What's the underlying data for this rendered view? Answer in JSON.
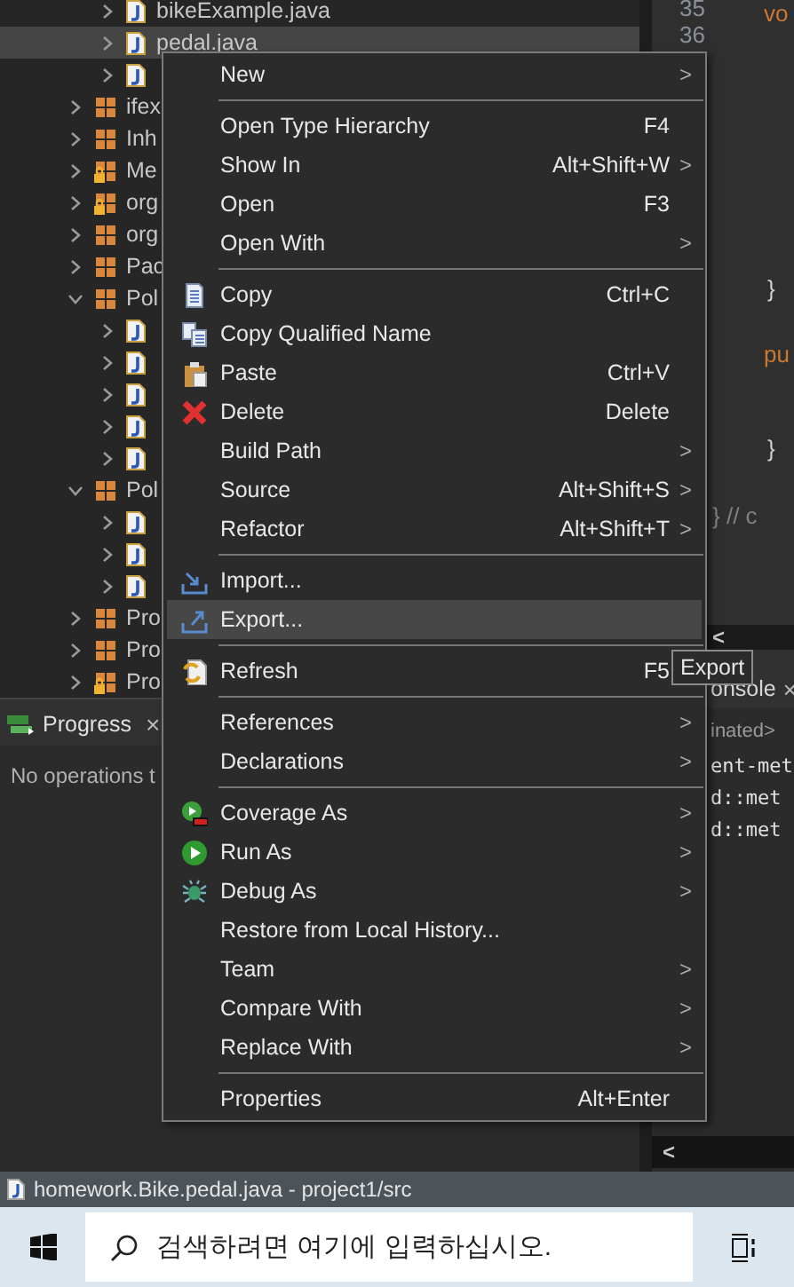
{
  "explorer": {
    "continued_files": [
      {
        "label": "bikeExample.java",
        "selected": false
      },
      {
        "label": "pedal.java",
        "selected": true
      },
      {
        "selected": false
      }
    ],
    "items": [
      {
        "label": "ifex",
        "locked": false,
        "expanded": false
      },
      {
        "label": "Inh",
        "locked": false,
        "expanded": false
      },
      {
        "label": "Me",
        "locked": true,
        "expanded": false
      },
      {
        "label": "org",
        "locked": true,
        "expanded": false
      },
      {
        "label": "org",
        "locked": false,
        "expanded": false
      },
      {
        "label": "Pac",
        "locked": false,
        "expanded": false
      },
      {
        "label": "Pol",
        "locked": false,
        "expanded": true,
        "children": [
          {
            "selected": false
          },
          {
            "selected": false
          },
          {
            "selected": false
          },
          {
            "selected": false
          },
          {
            "selected": false
          }
        ]
      },
      {
        "label": "Pol",
        "locked": false,
        "expanded": true,
        "children": [
          {
            "selected": false
          },
          {
            "selected": false
          },
          {
            "selected": false
          }
        ]
      },
      {
        "label": "Pro",
        "locked": false,
        "expanded": false
      },
      {
        "label": "Pro",
        "locked": false,
        "expanded": false
      },
      {
        "label": "Pro",
        "locked": true,
        "expanded": false
      }
    ]
  },
  "progress": {
    "tab": "Progress",
    "close": "×",
    "message": "No operations t"
  },
  "editor": {
    "line_numbers": [
      "35",
      "36"
    ],
    "code": [
      {
        "text": "vo",
        "kind": "keyword"
      },
      {
        "text": "}",
        "kind": "plain"
      },
      {
        "text": "pu",
        "kind": "keyword"
      },
      {
        "text": "}",
        "kind": "plain"
      },
      {
        "text": "} // c",
        "kind": "comment"
      }
    ],
    "scroll_arrow": "<"
  },
  "console": {
    "tab": "onsole",
    "close": "×",
    "status": "inated>",
    "lines": [
      "ent-met",
      "d::met",
      "d::met"
    ],
    "scroll_arrow": "<"
  },
  "context_menu": {
    "items": [
      {
        "kind": "item",
        "label": "New",
        "submenu": true,
        "selected": false
      },
      {
        "kind": "separator"
      },
      {
        "kind": "item",
        "label": "Open Type Hierarchy",
        "shortcut": "F4",
        "submenu": false,
        "selected": false
      },
      {
        "kind": "item",
        "label": "Show In",
        "shortcut": "Alt+Shift+W",
        "submenu": true,
        "selected": false
      },
      {
        "kind": "item",
        "label": "Open",
        "shortcut": "F3",
        "submenu": false,
        "selected": false
      },
      {
        "kind": "item",
        "label": "Open With",
        "submenu": true,
        "selected": false
      },
      {
        "kind": "separator"
      },
      {
        "kind": "item",
        "label": "Copy",
        "shortcut": "Ctrl+C",
        "submenu": false,
        "selected": false
      },
      {
        "kind": "item",
        "label": "Copy Qualified Name",
        "submenu": false,
        "selected": false
      },
      {
        "kind": "item",
        "label": "Paste",
        "shortcut": "Ctrl+V",
        "submenu": false,
        "selected": false
      },
      {
        "kind": "item",
        "label": "Delete",
        "shortcut": "Delete",
        "submenu": false,
        "selected": false
      },
      {
        "kind": "item",
        "label": "Build Path",
        "submenu": true,
        "selected": false
      },
      {
        "kind": "item",
        "label": "Source",
        "shortcut": "Alt+Shift+S",
        "submenu": true,
        "selected": false
      },
      {
        "kind": "item",
        "label": "Refactor",
        "shortcut": "Alt+Shift+T",
        "submenu": true,
        "selected": false
      },
      {
        "kind": "separator"
      },
      {
        "kind": "item",
        "label": "Import...",
        "submenu": false,
        "selected": false
      },
      {
        "kind": "item",
        "label": "Export...",
        "submenu": false,
        "selected": true
      },
      {
        "kind": "separator"
      },
      {
        "kind": "item",
        "label": "Refresh",
        "shortcut": "F5",
        "selected": false
      },
      {
        "kind": "separator"
      },
      {
        "kind": "item",
        "label": "References",
        "submenu": true,
        "selected": false
      },
      {
        "kind": "item",
        "label": "Declarations",
        "submenu": true,
        "selected": false
      },
      {
        "kind": "separator"
      },
      {
        "kind": "item",
        "label": "Coverage As",
        "submenu": true,
        "selected": false
      },
      {
        "kind": "item",
        "label": "Run As",
        "submenu": true,
        "selected": false
      },
      {
        "kind": "item",
        "label": "Debug As",
        "submenu": true,
        "selected": false
      },
      {
        "kind": "item",
        "label": "Restore from Local History...",
        "submenu": false,
        "selected": false
      },
      {
        "kind": "item",
        "label": "Team",
        "submenu": true,
        "selected": false
      },
      {
        "kind": "item",
        "label": "Compare With",
        "submenu": true,
        "selected": false
      },
      {
        "kind": "item",
        "label": "Replace With",
        "submenu": true,
        "selected": false
      },
      {
        "kind": "separator"
      },
      {
        "kind": "item",
        "label": "Properties",
        "shortcut": "Alt+Enter",
        "submenu": false,
        "selected": false
      }
    ],
    "submenu_arrow": ">"
  },
  "tooltip": "Export",
  "status_bar": "homework.Bike.pedal.java - project1/src",
  "taskbar": {
    "search": {
      "placeholder": "검색하려면 여기에 입력하십시오."
    }
  }
}
